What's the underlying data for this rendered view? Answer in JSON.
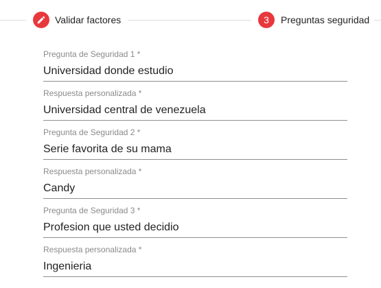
{
  "stepper": {
    "steps": [
      {
        "label": "Validar factores",
        "state": "editing",
        "icon": "pencil-icon"
      },
      {
        "label": "Preguntas seguridad",
        "state": "active",
        "number": "3"
      }
    ],
    "accent_color": "#e8383d"
  },
  "form": {
    "fields": [
      {
        "label": "Pregunta de Seguridad 1 *",
        "value": "Universidad donde estudio"
      },
      {
        "label": "Respuesta personalizada *",
        "value": "Universidad central de venezuela"
      },
      {
        "label": "Pregunta de Seguridad 2 *",
        "value": "Serie favorita de su mama"
      },
      {
        "label": "Respuesta personalizada *",
        "value": "Candy"
      },
      {
        "label": "Pregunta de Seguridad 3 *",
        "value": "Profesion que usted decidio"
      },
      {
        "label": "Respuesta personalizada *",
        "value": "Ingenieria"
      }
    ]
  }
}
